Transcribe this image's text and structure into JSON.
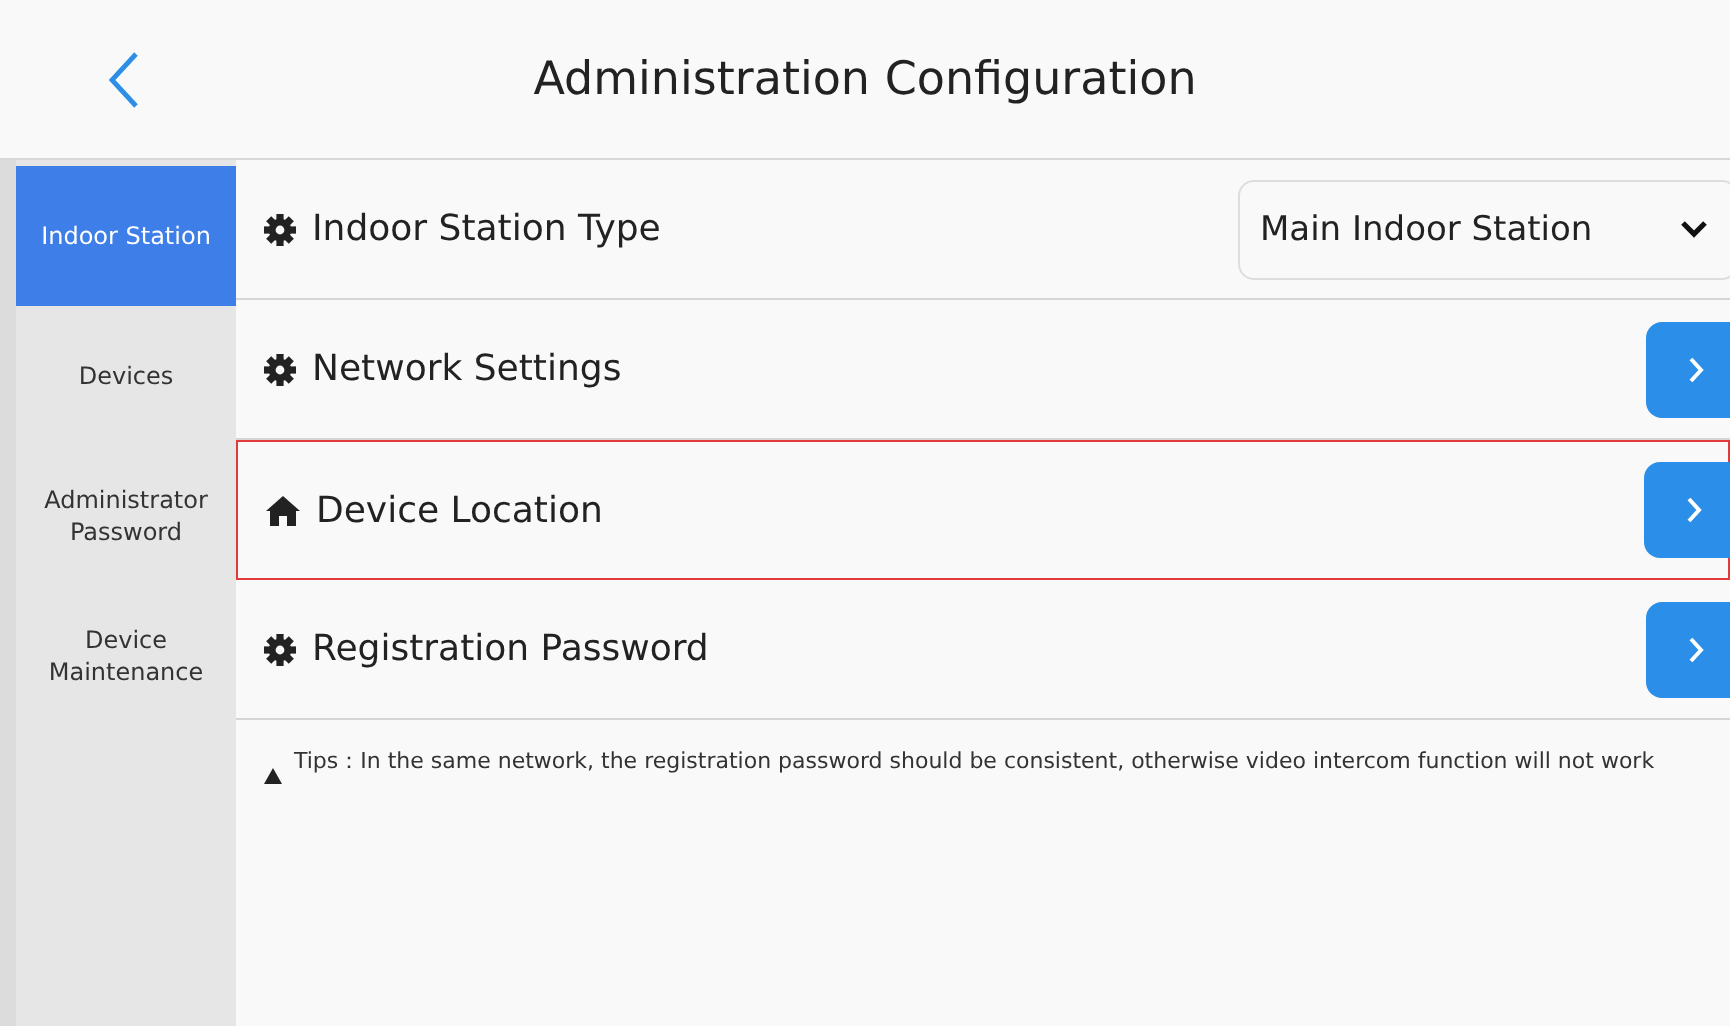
{
  "header": {
    "title": "Administration Configuration"
  },
  "sidebar": {
    "items": [
      {
        "label": "Indoor Station",
        "selected": true
      },
      {
        "label": "Devices",
        "selected": false
      },
      {
        "label": "Administrator Password",
        "selected": false
      },
      {
        "label": "Device Maintenance",
        "selected": false
      }
    ]
  },
  "settings": [
    {
      "label": "Indoor Station Type",
      "kind": "select",
      "value": "Main Indoor Station",
      "highlighted": false
    },
    {
      "label": "Network Settings",
      "kind": "link",
      "highlighted": false
    },
    {
      "label": "Device Location",
      "kind": "link",
      "highlighted": true
    },
    {
      "label": "Registration Password",
      "kind": "link",
      "highlighted": false
    }
  ],
  "tip": "Tips：In the same network, the registration password should be consistent, otherwise video intercom function will not work"
}
